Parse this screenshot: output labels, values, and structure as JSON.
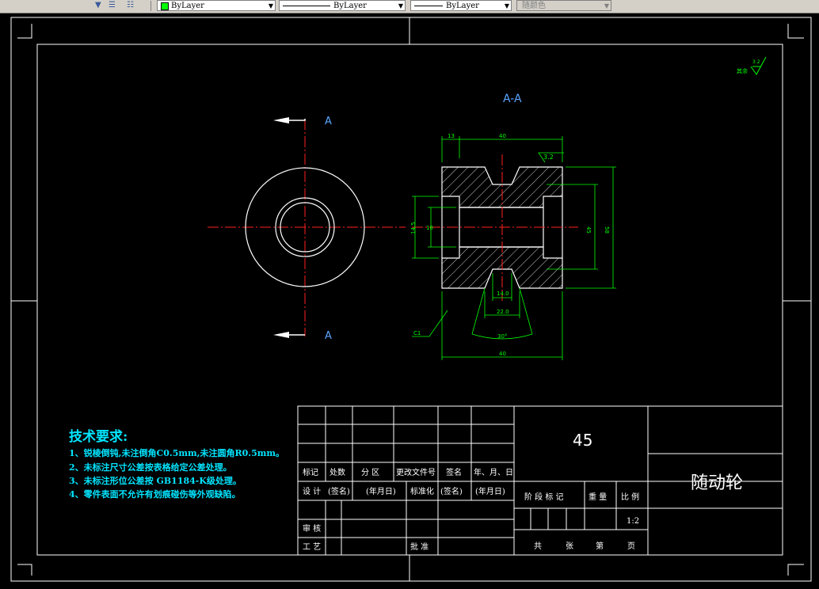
{
  "toolbar": {
    "color_dropdown": "ByLayer",
    "linetype_dropdown": "ByLayer",
    "lineweight_dropdown": "ByLayer",
    "plotstyle_dropdown": "随颜色"
  },
  "drawing": {
    "section_title": "A-A",
    "section_mark_top": "A",
    "section_mark_bottom": "A",
    "surface_finish_other": "其余",
    "surface_finish_other_value": "3.2",
    "roughness_value": "3.2",
    "dims": {
      "dim_top_left": "13",
      "dim_top_width": "40",
      "dim_right_inner": "45",
      "dim_right_outer": "58",
      "dim_bore_left": "14.5",
      "dim_bore_inner": "10",
      "dim_groove_width": "14.0",
      "dim_groove_bottom": "22.0",
      "dim_angle": "30°",
      "dim_overall_width": "40",
      "chamfer": "C1"
    },
    "requirements": {
      "title": "技术要求:",
      "items": [
        "1、锐棱倒钝,未注倒角C0.5mm,未注圆角R0.5mm。",
        "2、未标注尺寸公差按表格给定公差处理。",
        "3、未标注形位公差按 GB1184-K级处理。",
        "4、零件表面不允许有划痕碰伤等外观缺陷。"
      ]
    }
  },
  "title_block": {
    "material": "45",
    "part_name": "随动轮",
    "headers": [
      "标记",
      "处数",
      "分 区",
      "更改文件号",
      "签名",
      "年、月、日"
    ],
    "row_design": [
      "设 计",
      "(签名)",
      "(年月日)",
      "标准化",
      "(签名)",
      "(年月日)"
    ],
    "row_review": "审 核",
    "row_process": "工 艺",
    "approve": "批 准",
    "stage_headers": [
      "阶 段 标 记",
      "重 量",
      "比 例"
    ],
    "scale": "1:2",
    "sheets": [
      "共",
      "张",
      "第",
      "页"
    ]
  }
}
